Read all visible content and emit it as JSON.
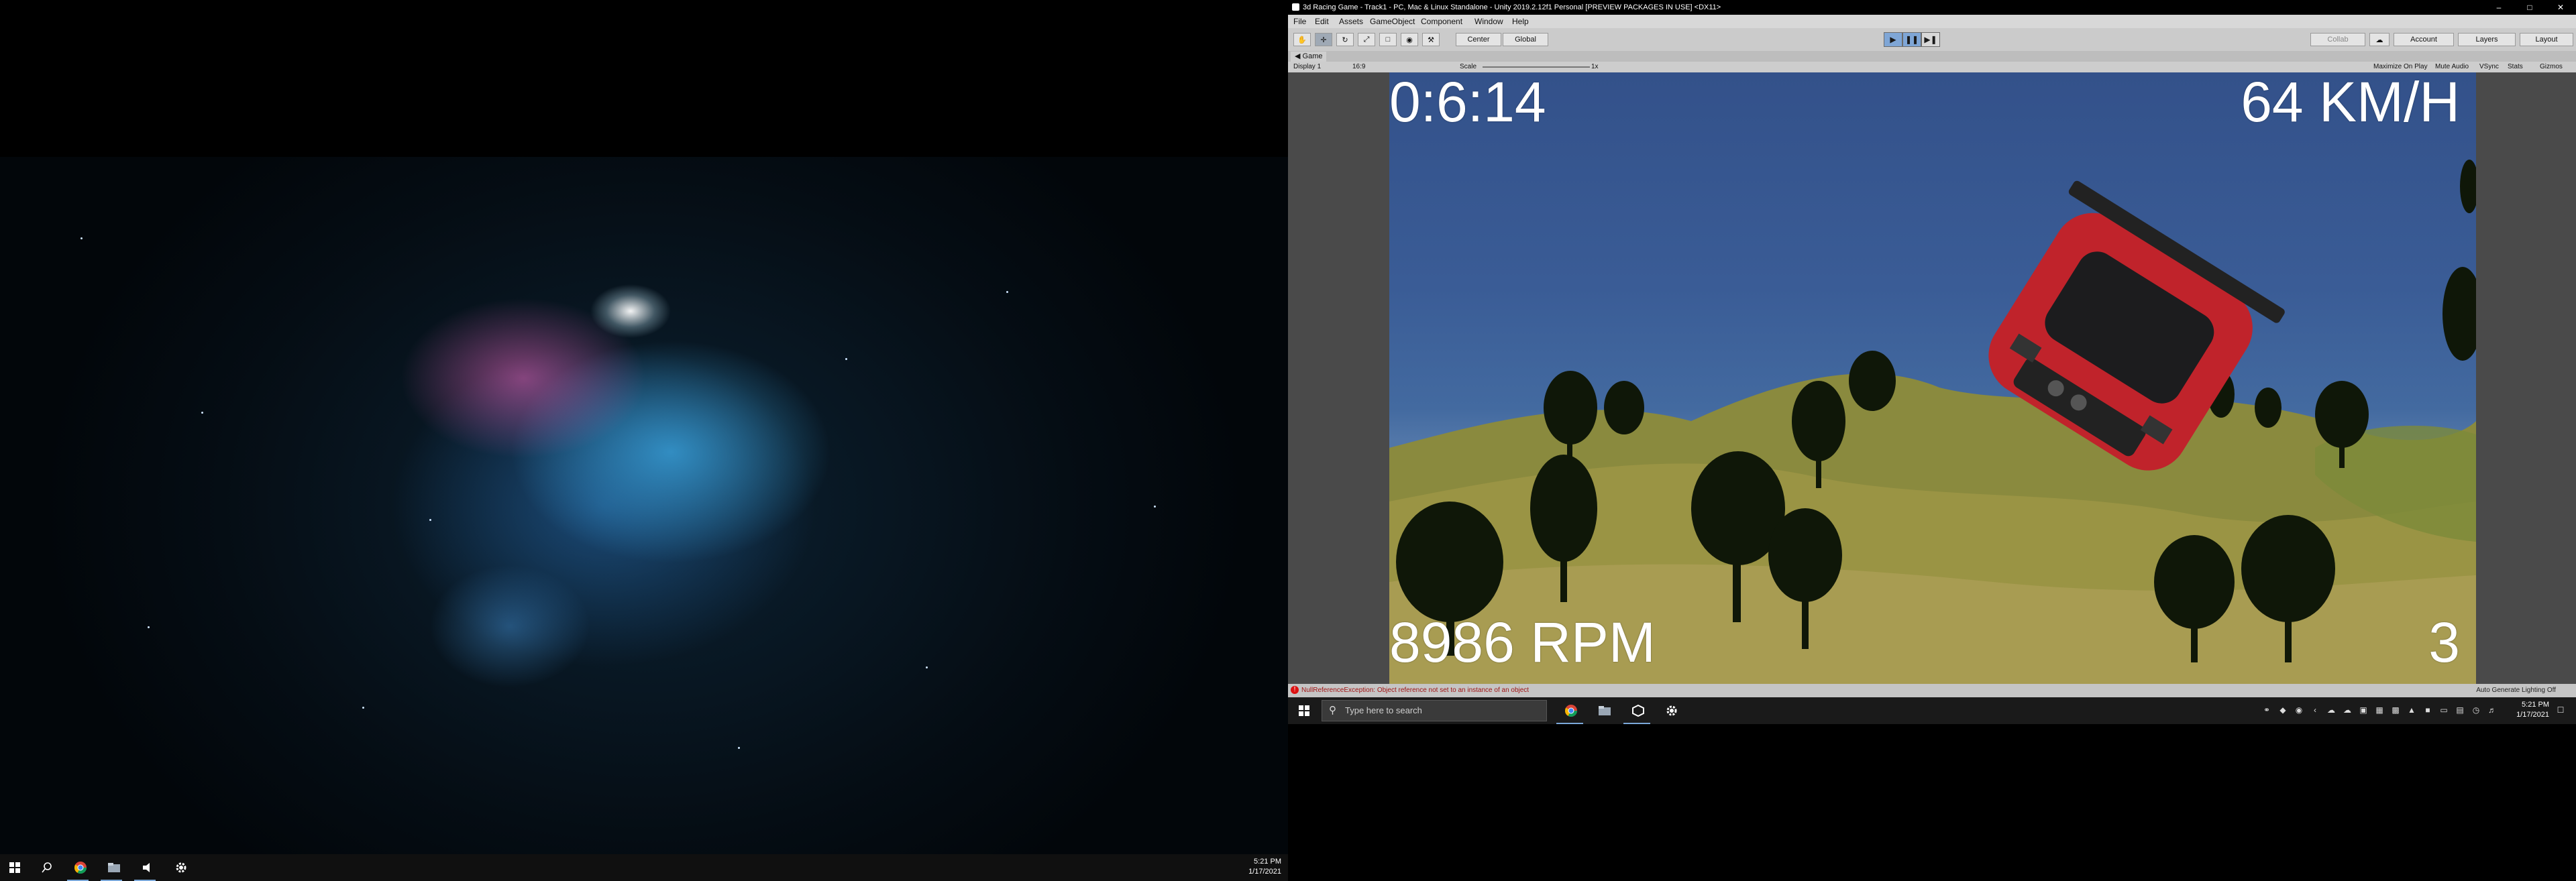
{
  "left_monitor": {
    "taskbar": {
      "start_icon": "windows-start-icon",
      "search_icon": "search-icon",
      "pinned": [
        {
          "name": "chrome-icon"
        },
        {
          "name": "file-explorer-icon"
        },
        {
          "name": "media-app-icon"
        },
        {
          "name": "settings-icon"
        }
      ],
      "clock_time": "5:21 PM",
      "clock_date": "1/17/2021"
    }
  },
  "unity": {
    "window_title": "3d Racing Game - Track1 - PC, Mac & Linux Standalone - Unity 2019.2.12f1 Personal [PREVIEW PACKAGES IN USE] <DX11>",
    "menu": [
      "File",
      "Edit",
      "Assets",
      "GameObject",
      "Component",
      "Window",
      "Help"
    ],
    "toolbar": {
      "pivot": "Center",
      "space": "Global",
      "collab": "Collab",
      "account": "Account",
      "layers": "Layers",
      "layout": "Layout"
    },
    "game_tab": "Game",
    "game_controls": {
      "display": "Display 1",
      "aspect": "16:9",
      "scale_label": "Scale",
      "scale_value": "1x",
      "maximize": "Maximize On Play",
      "mute": "Mute Audio",
      "vsync": "VSync",
      "stats": "Stats",
      "gizmos": "Gizmos"
    },
    "hud": {
      "timer": "0:6:14",
      "speed": "64 KM/H",
      "rpm": "8986 RPM",
      "gear": "3"
    },
    "status": {
      "message": "NullReferenceException: Object reference not set to an instance of an object",
      "right": "Auto Generate Lighting Off"
    },
    "colors": {
      "sky": "#3a5c96",
      "car": "#c0232b",
      "terrain": "#8a8a3e"
    }
  },
  "right_taskbar": {
    "search_placeholder": "Type here to search",
    "clock_time": "5:21 PM",
    "clock_date": "1/17/2021"
  }
}
